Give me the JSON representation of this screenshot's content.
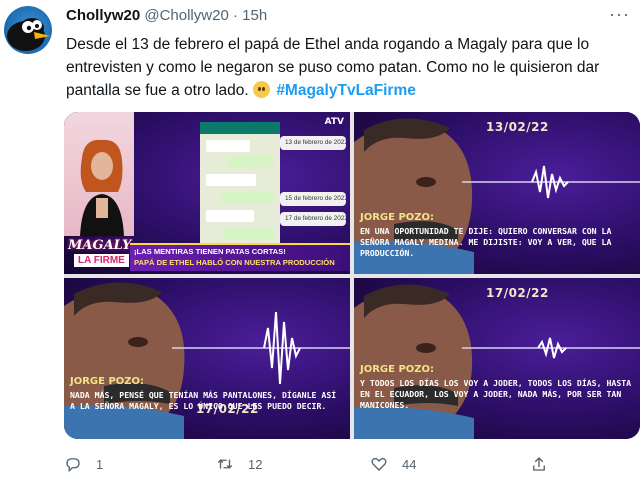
{
  "tweet": {
    "display_name": "Chollyw20",
    "handle": "@Chollyw20",
    "separator": "·",
    "time": "15h",
    "text_before_hashtag": "Desde el 13 de febrero el papá de Ethel anda rogando a Magaly para que lo entrevisten y como le negaron se puso como patan. Como no le quisieron dar pantalla se fue a otro lado. ",
    "hashtag": "#MagalyTvLaFirme",
    "more_label": "···"
  },
  "icons": {
    "avatar": "cartoon-avatar",
    "reply": "reply-icon",
    "retweet": "retweet-icon",
    "like": "heart-icon",
    "share": "share-icon",
    "more": "more-icon",
    "emoji": "grimace-emoji"
  },
  "media": {
    "tile1": {
      "channel": "ATV",
      "show_line1": "MAGALY",
      "show_line2": "LA FIRME",
      "banner_line1": "¡LAS MENTIRAS TIENEN PATAS CORTAS!",
      "banner_line2": "PAPÁ DE ETHEL HABLÓ CON NUESTRA PRODUCCIÓN",
      "chat_dates": [
        "13 de febrero de 2022",
        "15 de febrero de 2022",
        "17 de febrero de 2022"
      ]
    },
    "tile2": {
      "date": "13/02/22",
      "speaker": "JORGE POZO:",
      "quote": "EN UNA OPORTUNIDAD TE DIJE: QUIERO CONVERSAR CON LA SEÑORA MAGALY MEDINA. ME DIJISTE: VOY A VER, QUE LA PRODUCCIÓN."
    },
    "tile3": {
      "date": "17/02/22",
      "speaker": "JORGE POZO:",
      "quote": "NADA MÁS, PENSÉ QUE TENÍAN MÁS PANTALONES, DÍGANLE ASÍ A LA SEÑORA MAGALY, ES LO ÚNICO QUE LES PUEDO DECIR."
    },
    "tile4": {
      "date": "17/02/22",
      "speaker": "JORGE POZO:",
      "quote": "Y TODOS LOS DÍAS LOS VOY A JODER, TODOS LOS DÍAS, HASTA EN EL ECUADOR, LOS VOY A JODER, NADA MÁS, POR SER TAN MANICONES."
    }
  },
  "actions": {
    "reply_count": "1",
    "retweet_count": "12",
    "like_count": "44"
  },
  "colors": {
    "accent": "#1d9bf0",
    "muted": "#536471",
    "text": "#0f1419"
  }
}
